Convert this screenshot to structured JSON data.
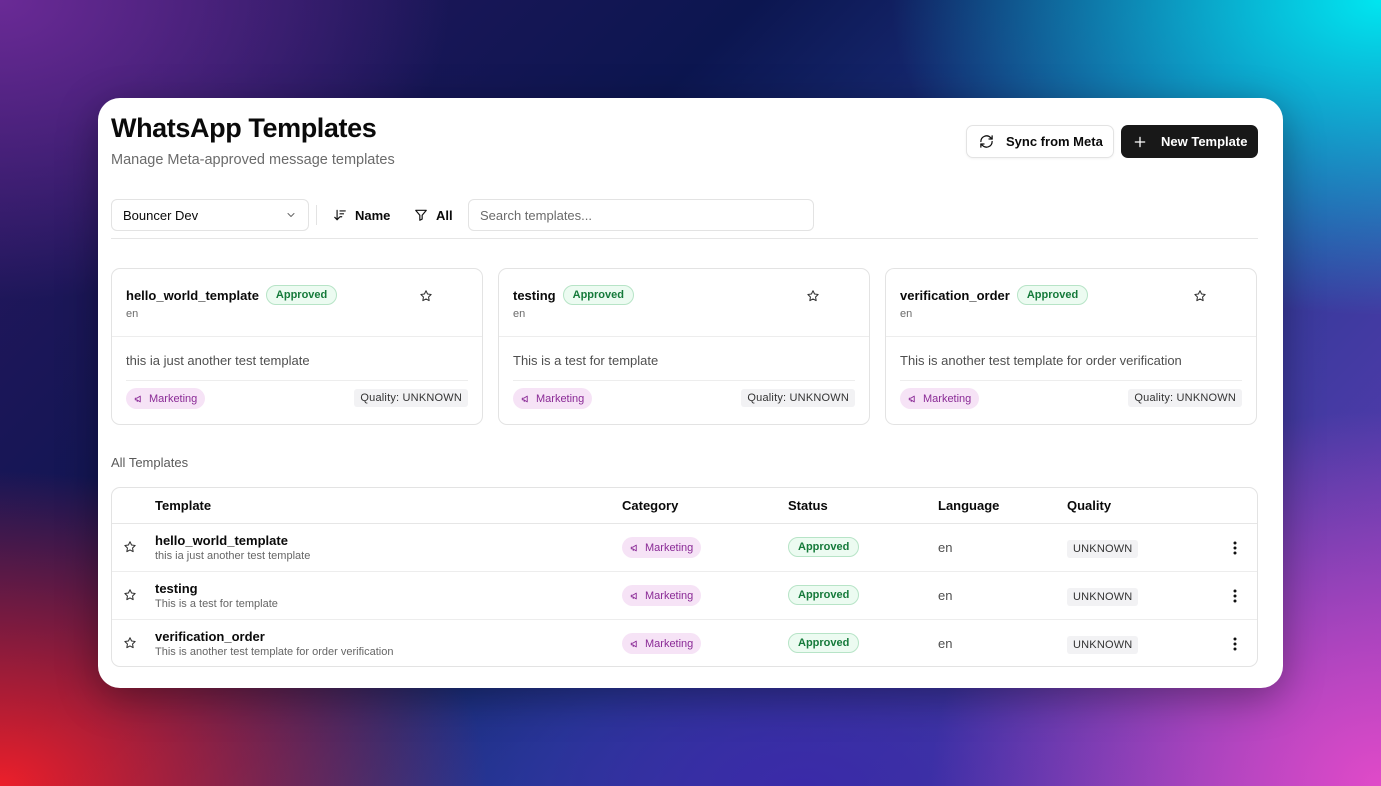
{
  "header": {
    "title": "WhatsApp Templates",
    "subtitle": "Manage Meta-approved message templates"
  },
  "actions": {
    "sync_label": "Sync from Meta",
    "new_label": "New Template"
  },
  "toolbar": {
    "workspace": "Bouncer Dev",
    "sort_label": "Name",
    "filter_label": "All",
    "search_placeholder": "Search templates..."
  },
  "featured": [
    {
      "name": "hello_world_template",
      "status": "Approved",
      "language": "en",
      "description": "this ia just another test template",
      "category": "Marketing",
      "quality": "Quality: UNKNOWN"
    },
    {
      "name": "testing",
      "status": "Approved",
      "language": "en",
      "description": "This is a test for template",
      "category": "Marketing",
      "quality": "Quality: UNKNOWN"
    },
    {
      "name": "verification_order",
      "status": "Approved",
      "language": "en",
      "description": "This is another test template for order verification",
      "category": "Marketing",
      "quality": "Quality: UNKNOWN"
    }
  ],
  "section_title": "All Templates",
  "table": {
    "columns": [
      "Template",
      "Category",
      "Status",
      "Language",
      "Quality"
    ],
    "rows": [
      {
        "name": "hello_world_template",
        "description": "this ia just another test template",
        "category": "Marketing",
        "status": "Approved",
        "language": "en",
        "quality": "UNKNOWN"
      },
      {
        "name": "testing",
        "description": "This is a test for template",
        "category": "Marketing",
        "status": "Approved",
        "language": "en",
        "quality": "UNKNOWN"
      },
      {
        "name": "verification_order",
        "description": "This is another test template for order verification",
        "category": "Marketing",
        "status": "Approved",
        "language": "en",
        "quality": "UNKNOWN"
      }
    ]
  },
  "icons": {
    "sync": "refresh-icon",
    "new": "plus-icon",
    "select": "chevron-down-icon",
    "sort": "sort-icon",
    "filter": "filter-icon",
    "star": "star-icon",
    "category": "megaphone-icon",
    "row_menu": "more-vertical-icon"
  },
  "colors": {
    "approved_text": "#157a3a",
    "approved_bg": "#ecfbf1",
    "category_text": "#8a2a96",
    "category_bg": "#f6e3f6",
    "primary_button": "#181818"
  }
}
